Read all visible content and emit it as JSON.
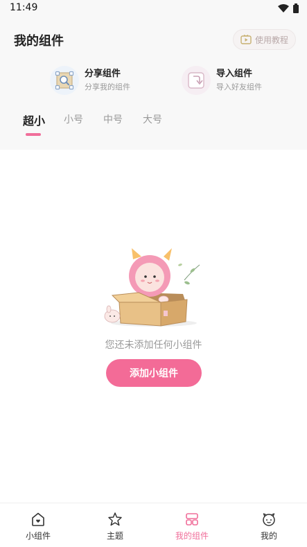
{
  "status_bar": {
    "time": "11:49"
  },
  "header": {
    "title": "我的组件",
    "tutorial_label": "使用教程"
  },
  "actions": [
    {
      "title": "分享组件",
      "subtitle": "分享我的组件"
    },
    {
      "title": "导入组件",
      "subtitle": "导入好友组件"
    }
  ],
  "tabs": [
    "超小",
    "小号",
    "中号",
    "大号"
  ],
  "active_tab": "超小",
  "empty_state": {
    "message": "您还未添加任何小组件",
    "button_label": "添加小组件"
  },
  "bottom_nav": [
    {
      "label": "小组件",
      "icon": "home-icon"
    },
    {
      "label": "主题",
      "icon": "star-icon"
    },
    {
      "label": "我的组件",
      "icon": "grid-icon",
      "active": true
    },
    {
      "label": "我的",
      "icon": "profile-icon"
    }
  ],
  "colors": {
    "accent": "#f06e9a",
    "button": "#f36b97"
  }
}
